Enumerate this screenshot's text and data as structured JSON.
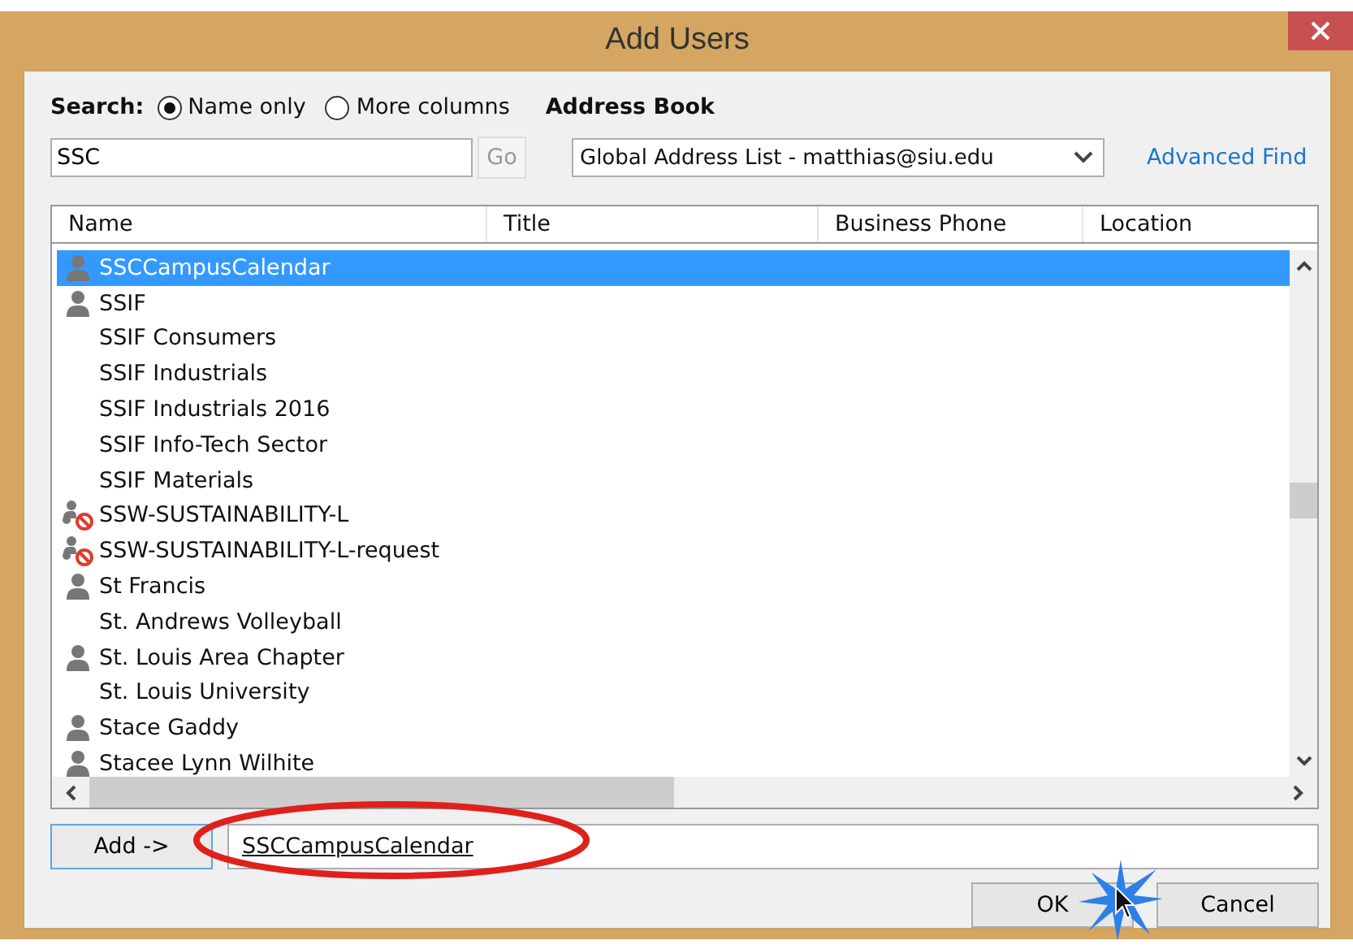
{
  "window": {
    "title": "Add Users"
  },
  "search": {
    "label": "Search:",
    "options": [
      {
        "label": "Name only",
        "selected": true
      },
      {
        "label": "More columns",
        "selected": false
      }
    ],
    "value": "SSC",
    "go_button": {
      "label": "Go",
      "disabled": true
    }
  },
  "address_book": {
    "label": "Address Book",
    "value": "Global Address List - matthias@siu.edu"
  },
  "advanced_find": "Advanced Find",
  "table": {
    "columns": [
      "Name",
      "Title",
      "Business Phone",
      "Location"
    ],
    "rows": [
      {
        "name": "SSCCampusCalendar",
        "kind": "user",
        "selected": true
      },
      {
        "name": "SSIF",
        "kind": "user",
        "selected": false
      },
      {
        "name": "SSIF Consumers",
        "kind": "group",
        "selected": false
      },
      {
        "name": "SSIF Industrials",
        "kind": "group",
        "selected": false
      },
      {
        "name": "SSIF Industrials 2016",
        "kind": "group",
        "selected": false
      },
      {
        "name": "SSIF Info-Tech Sector",
        "kind": "group",
        "selected": false
      },
      {
        "name": "SSIF Materials",
        "kind": "group",
        "selected": false
      },
      {
        "name": "SSW-SUSTAINABILITY-L",
        "kind": "restricted",
        "selected": false
      },
      {
        "name": "SSW-SUSTAINABILITY-L-request",
        "kind": "restricted",
        "selected": false
      },
      {
        "name": "St Francis",
        "kind": "user",
        "selected": false
      },
      {
        "name": "St. Andrews Volleyball",
        "kind": "group",
        "selected": false
      },
      {
        "name": "St. Louis Area Chapter",
        "kind": "user",
        "selected": false
      },
      {
        "name": "St. Louis University",
        "kind": "group",
        "selected": false
      },
      {
        "name": "Stace Gaddy",
        "kind": "user",
        "selected": false
      },
      {
        "name": "Stacee Lynn Wilhite",
        "kind": "user",
        "selected": false
      }
    ]
  },
  "add_button": "Add ->",
  "recipients": {
    "value": "SSCCampusCalendar"
  },
  "buttons": [
    {
      "label": "OK"
    },
    {
      "label": "Cancel"
    }
  ]
}
